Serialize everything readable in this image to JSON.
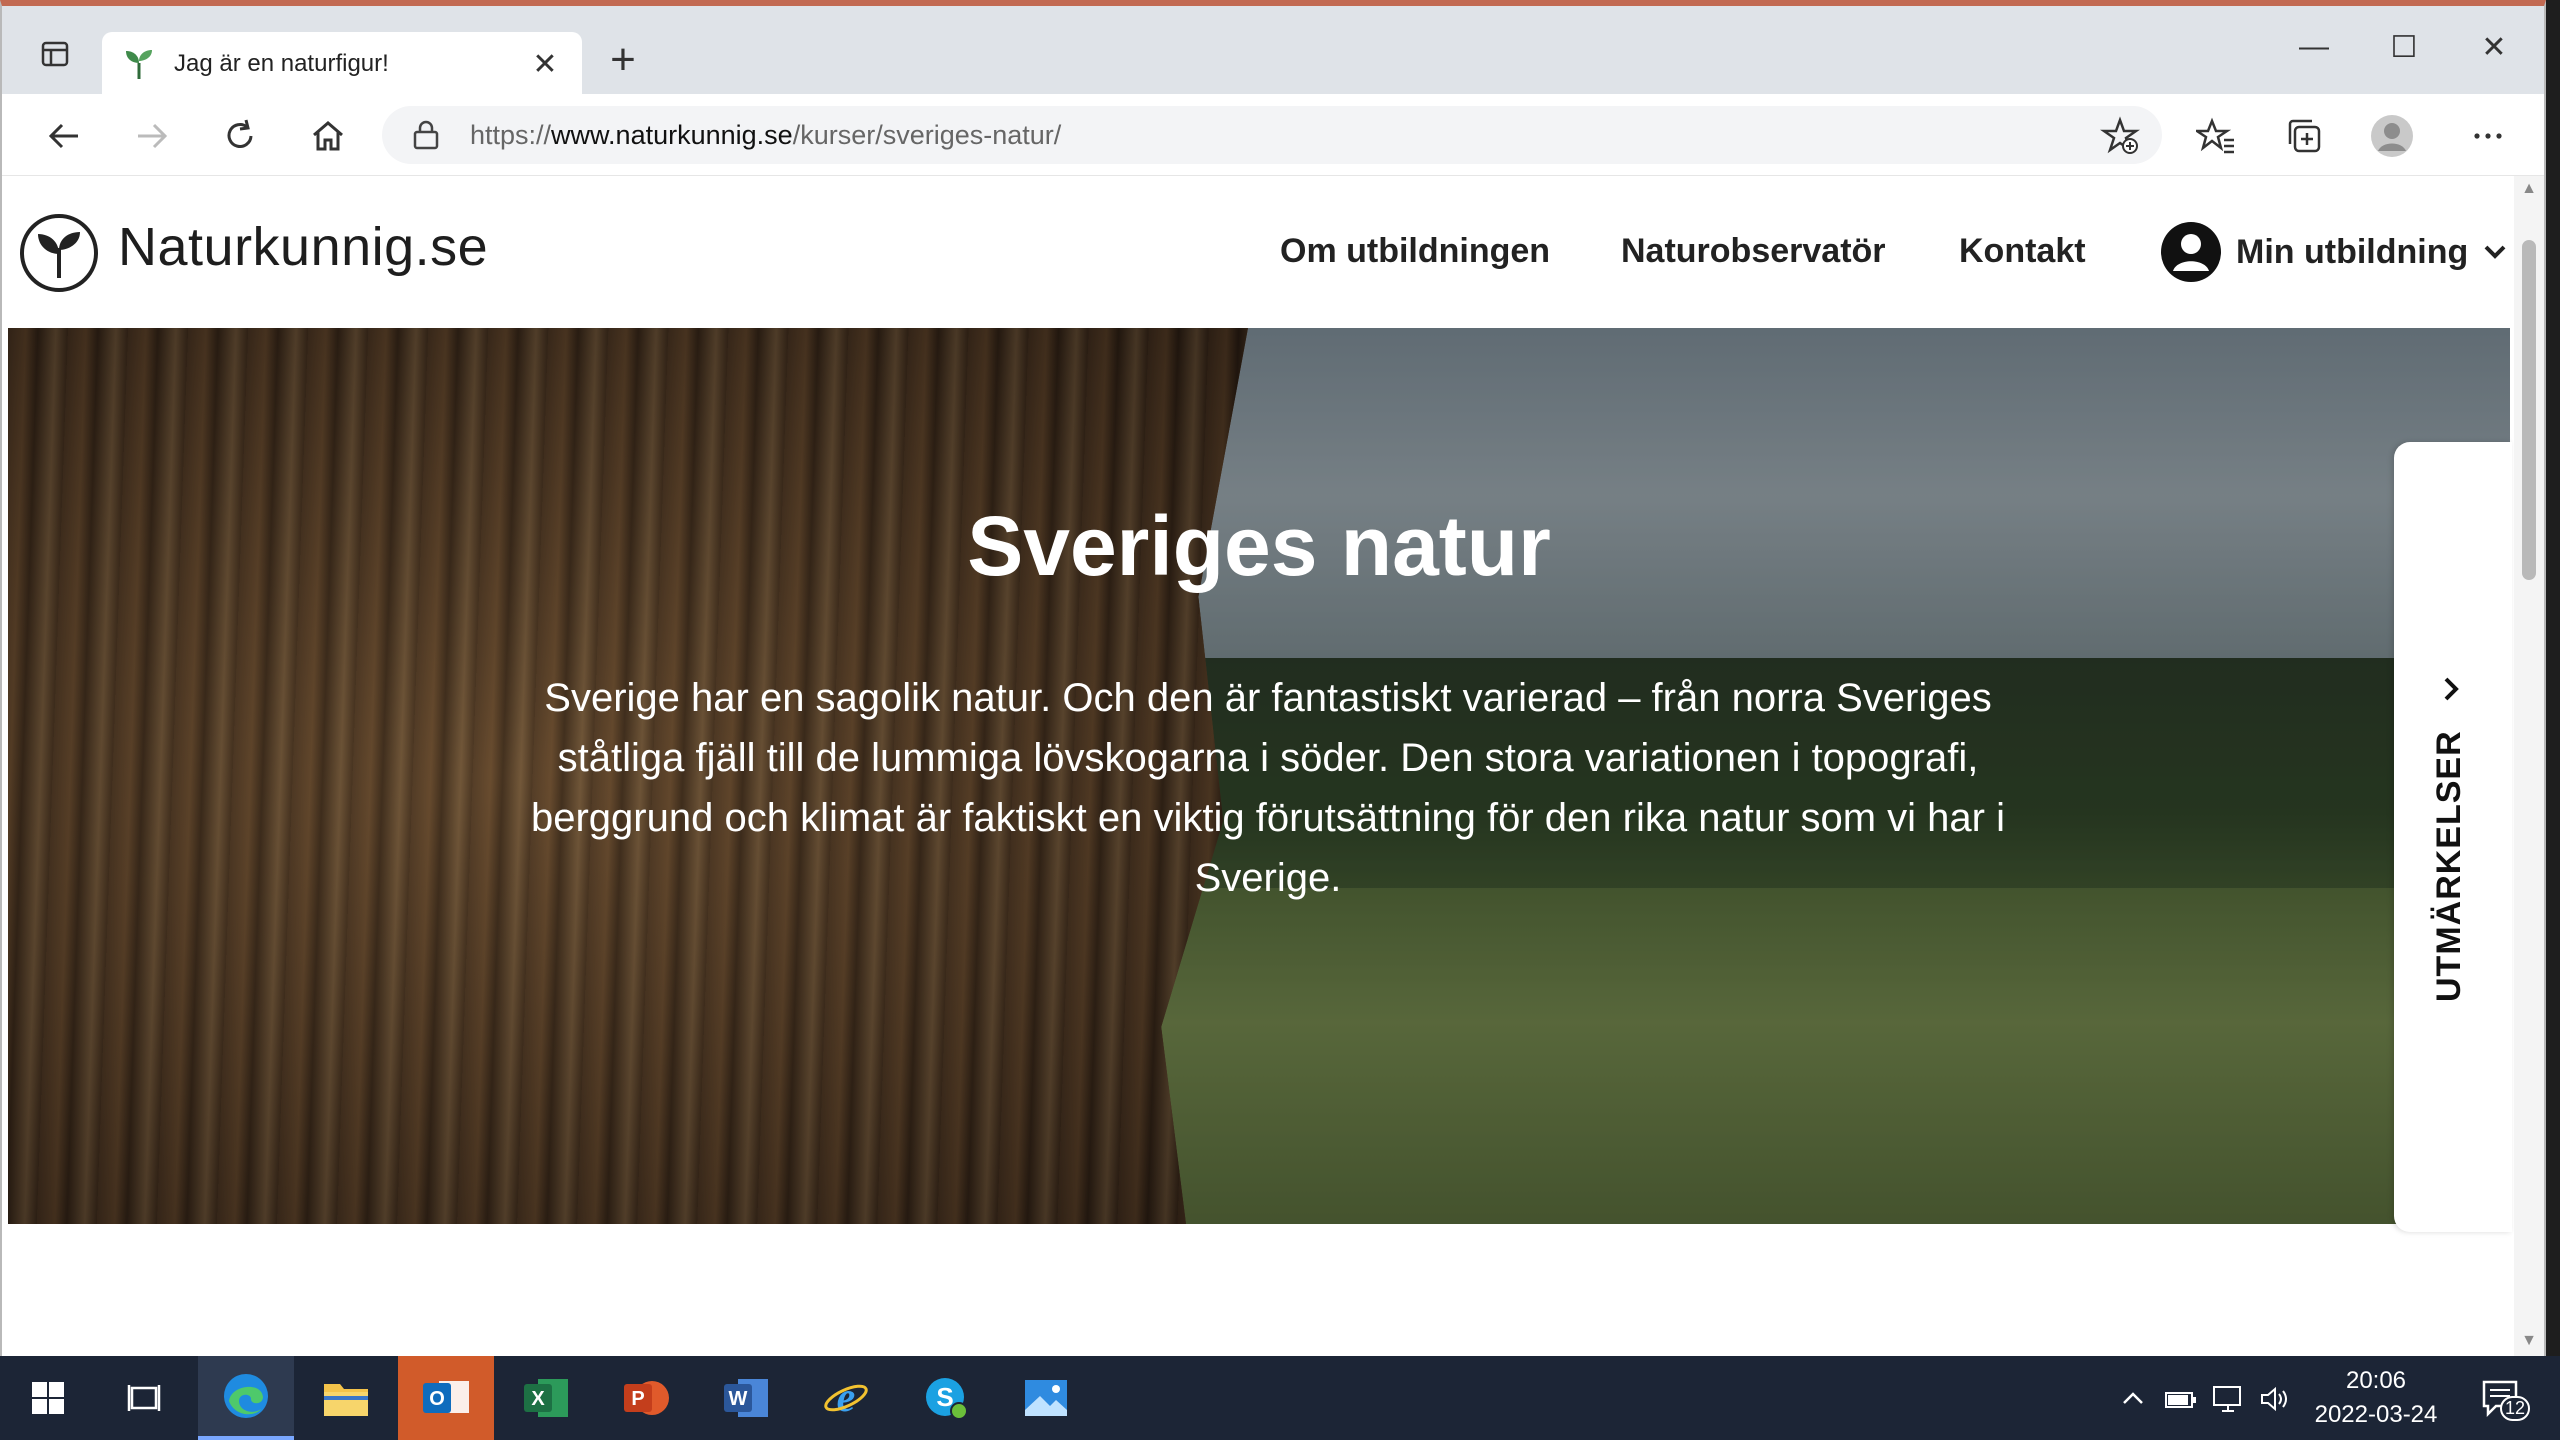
{
  "browser": {
    "tab_title": "Jag är en naturfigur!",
    "tab_close": "✕",
    "new_tab": "+",
    "url_prefix": "https://",
    "url_host": "www.naturkunnig.se",
    "url_path": "/kurser/sveriges-natur/"
  },
  "site": {
    "brand": "Naturkunnig.se",
    "nav": [
      "Om utbildningen",
      "Naturobservatör",
      "Kontakt"
    ],
    "account_label": "Min utbildning"
  },
  "hero": {
    "title": "Sveriges natur",
    "text": "Sverige har en sagolik natur. Och den är fantastiskt varierad – från norra Sveriges ståtliga fjäll till de lummiga lövskogarna i söder. Den stora variationen i topografi, berggrund och klimat är faktiskt en viktig förutsättning för den rika natur som vi har i Sverige."
  },
  "side_tab": {
    "label": "UTMÄRKELSER"
  },
  "taskbar": {
    "time": "20:06",
    "date": "2022-03-24",
    "notification_count": "12"
  },
  "colors": {
    "taskbar_bg": "#1c2536",
    "outlook_highlight": "#d15b2a",
    "excel_green": "#1d7044",
    "powerpoint_red": "#c43e1c",
    "word_blue": "#2b579a"
  }
}
